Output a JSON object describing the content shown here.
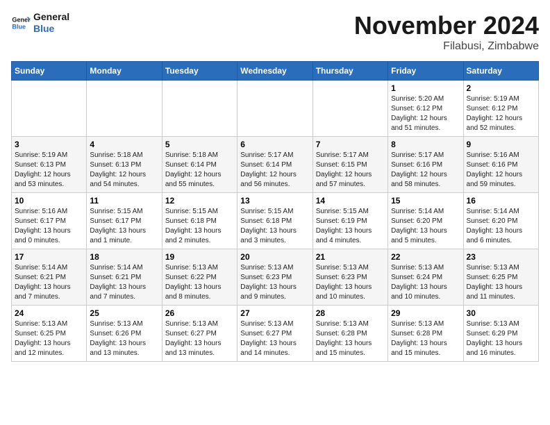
{
  "logo": {
    "text_general": "General",
    "text_blue": "Blue"
  },
  "title": "November 2024",
  "location": "Filabusi, Zimbabwe",
  "weekdays": [
    "Sunday",
    "Monday",
    "Tuesday",
    "Wednesday",
    "Thursday",
    "Friday",
    "Saturday"
  ],
  "weeks": [
    [
      {
        "day": "",
        "info": ""
      },
      {
        "day": "",
        "info": ""
      },
      {
        "day": "",
        "info": ""
      },
      {
        "day": "",
        "info": ""
      },
      {
        "day": "",
        "info": ""
      },
      {
        "day": "1",
        "info": "Sunrise: 5:20 AM\nSunset: 6:12 PM\nDaylight: 12 hours\nand 51 minutes."
      },
      {
        "day": "2",
        "info": "Sunrise: 5:19 AM\nSunset: 6:12 PM\nDaylight: 12 hours\nand 52 minutes."
      }
    ],
    [
      {
        "day": "3",
        "info": "Sunrise: 5:19 AM\nSunset: 6:13 PM\nDaylight: 12 hours\nand 53 minutes."
      },
      {
        "day": "4",
        "info": "Sunrise: 5:18 AM\nSunset: 6:13 PM\nDaylight: 12 hours\nand 54 minutes."
      },
      {
        "day": "5",
        "info": "Sunrise: 5:18 AM\nSunset: 6:14 PM\nDaylight: 12 hours\nand 55 minutes."
      },
      {
        "day": "6",
        "info": "Sunrise: 5:17 AM\nSunset: 6:14 PM\nDaylight: 12 hours\nand 56 minutes."
      },
      {
        "day": "7",
        "info": "Sunrise: 5:17 AM\nSunset: 6:15 PM\nDaylight: 12 hours\nand 57 minutes."
      },
      {
        "day": "8",
        "info": "Sunrise: 5:17 AM\nSunset: 6:16 PM\nDaylight: 12 hours\nand 58 minutes."
      },
      {
        "day": "9",
        "info": "Sunrise: 5:16 AM\nSunset: 6:16 PM\nDaylight: 12 hours\nand 59 minutes."
      }
    ],
    [
      {
        "day": "10",
        "info": "Sunrise: 5:16 AM\nSunset: 6:17 PM\nDaylight: 13 hours\nand 0 minutes."
      },
      {
        "day": "11",
        "info": "Sunrise: 5:15 AM\nSunset: 6:17 PM\nDaylight: 13 hours\nand 1 minute."
      },
      {
        "day": "12",
        "info": "Sunrise: 5:15 AM\nSunset: 6:18 PM\nDaylight: 13 hours\nand 2 minutes."
      },
      {
        "day": "13",
        "info": "Sunrise: 5:15 AM\nSunset: 6:18 PM\nDaylight: 13 hours\nand 3 minutes."
      },
      {
        "day": "14",
        "info": "Sunrise: 5:15 AM\nSunset: 6:19 PM\nDaylight: 13 hours\nand 4 minutes."
      },
      {
        "day": "15",
        "info": "Sunrise: 5:14 AM\nSunset: 6:20 PM\nDaylight: 13 hours\nand 5 minutes."
      },
      {
        "day": "16",
        "info": "Sunrise: 5:14 AM\nSunset: 6:20 PM\nDaylight: 13 hours\nand 6 minutes."
      }
    ],
    [
      {
        "day": "17",
        "info": "Sunrise: 5:14 AM\nSunset: 6:21 PM\nDaylight: 13 hours\nand 7 minutes."
      },
      {
        "day": "18",
        "info": "Sunrise: 5:14 AM\nSunset: 6:21 PM\nDaylight: 13 hours\nand 7 minutes."
      },
      {
        "day": "19",
        "info": "Sunrise: 5:13 AM\nSunset: 6:22 PM\nDaylight: 13 hours\nand 8 minutes."
      },
      {
        "day": "20",
        "info": "Sunrise: 5:13 AM\nSunset: 6:23 PM\nDaylight: 13 hours\nand 9 minutes."
      },
      {
        "day": "21",
        "info": "Sunrise: 5:13 AM\nSunset: 6:23 PM\nDaylight: 13 hours\nand 10 minutes."
      },
      {
        "day": "22",
        "info": "Sunrise: 5:13 AM\nSunset: 6:24 PM\nDaylight: 13 hours\nand 10 minutes."
      },
      {
        "day": "23",
        "info": "Sunrise: 5:13 AM\nSunset: 6:25 PM\nDaylight: 13 hours\nand 11 minutes."
      }
    ],
    [
      {
        "day": "24",
        "info": "Sunrise: 5:13 AM\nSunset: 6:25 PM\nDaylight: 13 hours\nand 12 minutes."
      },
      {
        "day": "25",
        "info": "Sunrise: 5:13 AM\nSunset: 6:26 PM\nDaylight: 13 hours\nand 13 minutes."
      },
      {
        "day": "26",
        "info": "Sunrise: 5:13 AM\nSunset: 6:27 PM\nDaylight: 13 hours\nand 13 minutes."
      },
      {
        "day": "27",
        "info": "Sunrise: 5:13 AM\nSunset: 6:27 PM\nDaylight: 13 hours\nand 14 minutes."
      },
      {
        "day": "28",
        "info": "Sunrise: 5:13 AM\nSunset: 6:28 PM\nDaylight: 13 hours\nand 15 minutes."
      },
      {
        "day": "29",
        "info": "Sunrise: 5:13 AM\nSunset: 6:28 PM\nDaylight: 13 hours\nand 15 minutes."
      },
      {
        "day": "30",
        "info": "Sunrise: 5:13 AM\nSunset: 6:29 PM\nDaylight: 13 hours\nand 16 minutes."
      }
    ]
  ]
}
